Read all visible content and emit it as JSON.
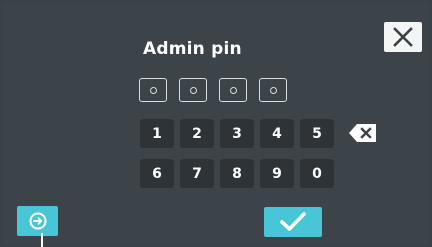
{
  "dialog": {
    "title": "Admin pin",
    "pin_length": 4,
    "pin_entered": 0
  },
  "keypad": {
    "row1": [
      "1",
      "2",
      "3",
      "4",
      "5"
    ],
    "row2": [
      "6",
      "7",
      "8",
      "9",
      "0"
    ]
  },
  "icons": {
    "close": "close-icon",
    "backspace": "backspace-icon",
    "left_action": "circle-arrow-icon",
    "confirm": "checkmark-icon"
  },
  "colors": {
    "background": "#3c4449",
    "key": "#2d3337",
    "accent": "#48c5d7",
    "text": "#ffffff"
  }
}
